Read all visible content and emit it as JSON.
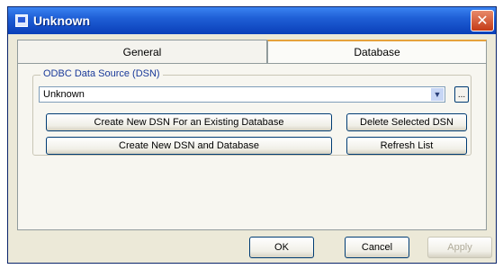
{
  "window": {
    "title": "Unknown",
    "close_glyph": "✕"
  },
  "tabs": [
    {
      "label": "General"
    },
    {
      "label": "Database"
    }
  ],
  "odbc": {
    "group_label": "ODBC Data Source (DSN)",
    "selected_dsn": "Unknown",
    "dropdown_arrow_glyph": "▼",
    "browse_label": "..."
  },
  "buttons": {
    "create_existing": "Create New DSN For an Existing Database",
    "create_new": "Create New DSN and Database",
    "delete_selected": "Delete Selected DSN",
    "refresh": "Refresh List",
    "ok": "OK",
    "cancel": "Cancel",
    "apply": "Apply"
  },
  "colors": {
    "titlebar": "#1f5fd6",
    "close": "#c43a16",
    "dialog_bg": "#ece9d8",
    "tab_accent": "#e6a23c"
  }
}
